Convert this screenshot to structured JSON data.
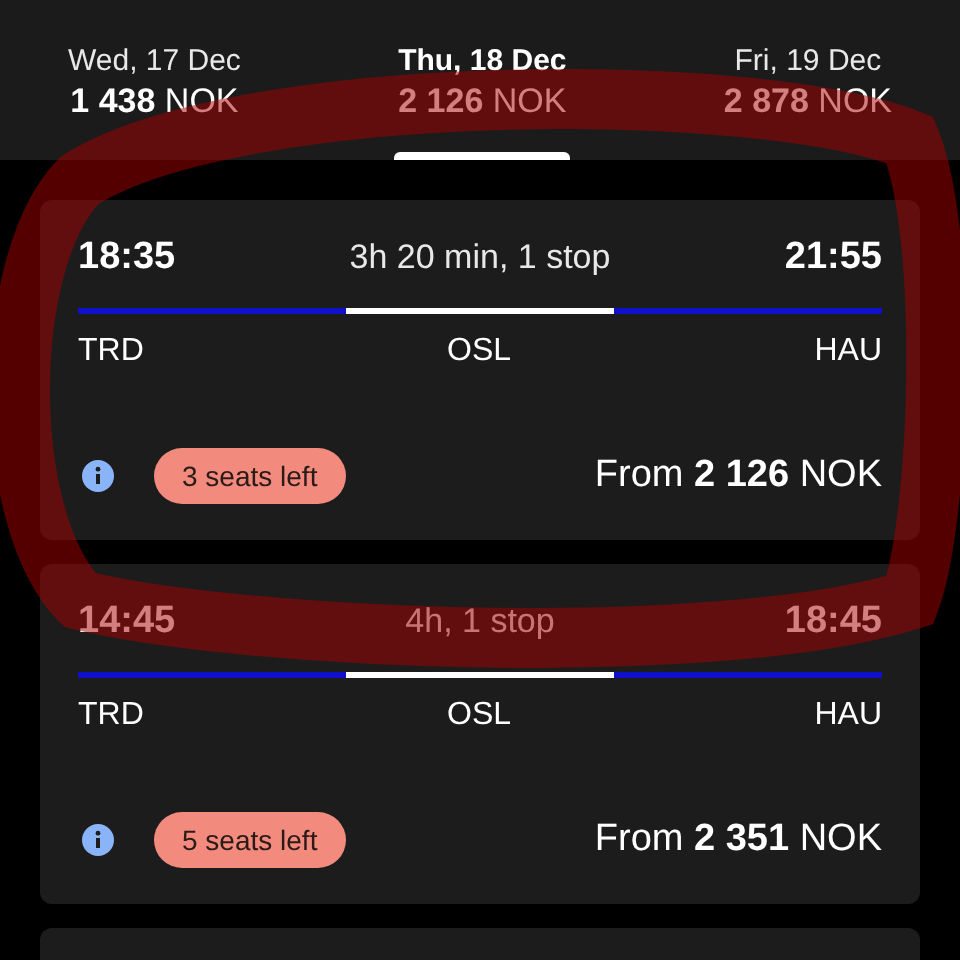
{
  "dates": [
    {
      "day": "Wed, 17 Dec",
      "price": "**1 438** NOK",
      "selected": false
    },
    {
      "day": "Thu, 18 Dec",
      "price": "**2 126** NOK",
      "selected": true
    },
    {
      "day": "Fri, 19 Dec",
      "price": "**2 878** NOK",
      "selected": false
    }
  ],
  "flights": [
    {
      "depart": "18:35",
      "duration": "3h 20 min, 1 stop",
      "arrive": "21:55",
      "airports": [
        "TRD",
        "OSL",
        "HAU"
      ],
      "seats": "3 seats left",
      "price": "From **2 126** NOK"
    },
    {
      "depart": "14:45",
      "duration": "4h, 1 stop",
      "arrive": "18:45",
      "airports": [
        "TRD",
        "OSL",
        "HAU"
      ],
      "seats": "5 seats left",
      "price": "From **2 351** NOK"
    }
  ],
  "annotation": {
    "kind": "ellipse"
  }
}
